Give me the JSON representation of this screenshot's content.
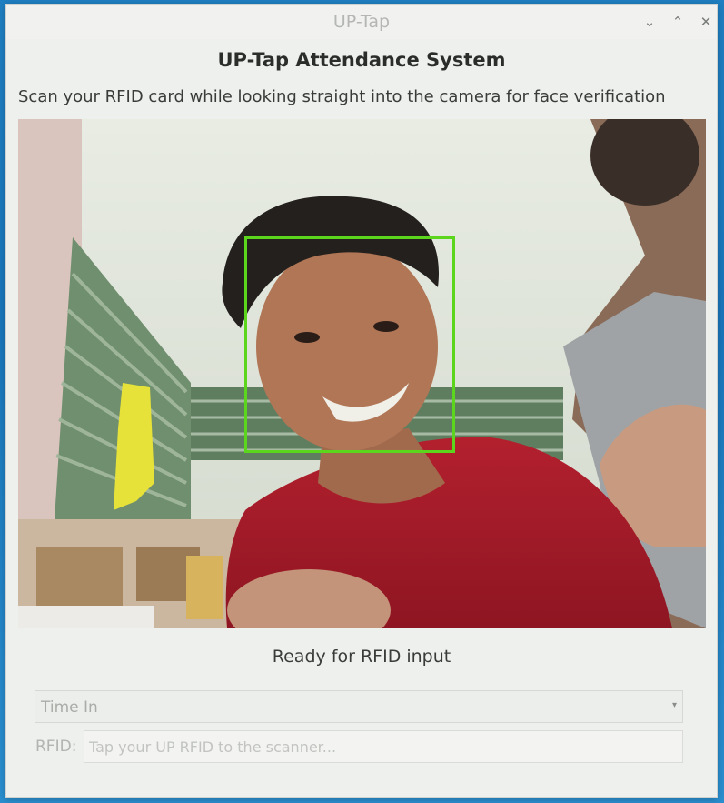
{
  "window": {
    "title": "UP-Tap",
    "controls": {
      "minimize_icon": "chevron-down-icon",
      "maximize_icon": "chevron-up-icon",
      "close_icon": "close-icon"
    }
  },
  "app": {
    "title": "UP-Tap Attendance System",
    "instruction": "Scan your RFID card while looking straight into the camera for face verification"
  },
  "camera": {
    "face_detected": true,
    "face_box_color": "#5cd61c"
  },
  "status": {
    "text": "Ready for RFID input"
  },
  "mode_select": {
    "selected": "Time In"
  },
  "rfid": {
    "label": "RFID:",
    "placeholder": "Tap your UP RFID to the scanner...",
    "value": ""
  }
}
